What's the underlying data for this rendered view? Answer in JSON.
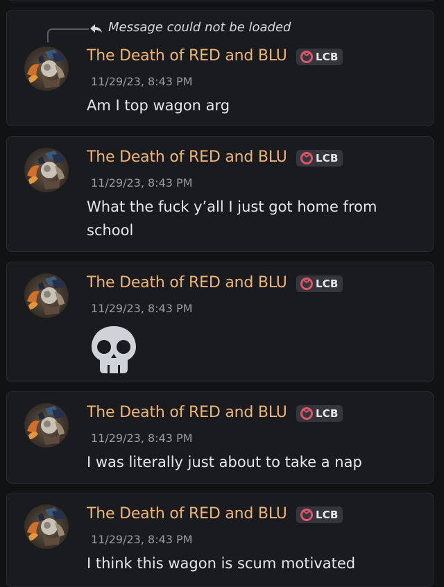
{
  "reply": {
    "text": "Message could not be loaded",
    "icon": "reply-arrow-icon"
  },
  "tag": {
    "label": "LCB",
    "icon": "lcb-ring-icon"
  },
  "colors": {
    "background": "#111214",
    "card": "#1a1b1f",
    "username": "#f0b474",
    "timestamp": "#9b9ca3",
    "text": "#e6e7ea",
    "tag_bg": "#34363c",
    "tag_icon": "#e0546a"
  },
  "messages": [
    {
      "author": "The Death of RED and BLU",
      "timestamp": "11/29/23, 8:43 PM",
      "content": "Am I top wagon arg"
    },
    {
      "author": "The Death of RED and BLU",
      "timestamp": "11/29/23, 8:43 PM",
      "content": "What the fuck y’all I just got home from school"
    },
    {
      "author": "The Death of RED and BLU",
      "timestamp": "11/29/23, 8:43 PM",
      "content": "",
      "emoji": "skull-emoji"
    },
    {
      "author": "The Death of RED and BLU",
      "timestamp": "11/29/23, 8:43 PM",
      "content": "I was literally just about to take a nap"
    },
    {
      "author": "The Death of RED and BLU",
      "timestamp": "11/29/23, 8:43 PM",
      "content": "I think this wagon is scum motivated"
    }
  ]
}
